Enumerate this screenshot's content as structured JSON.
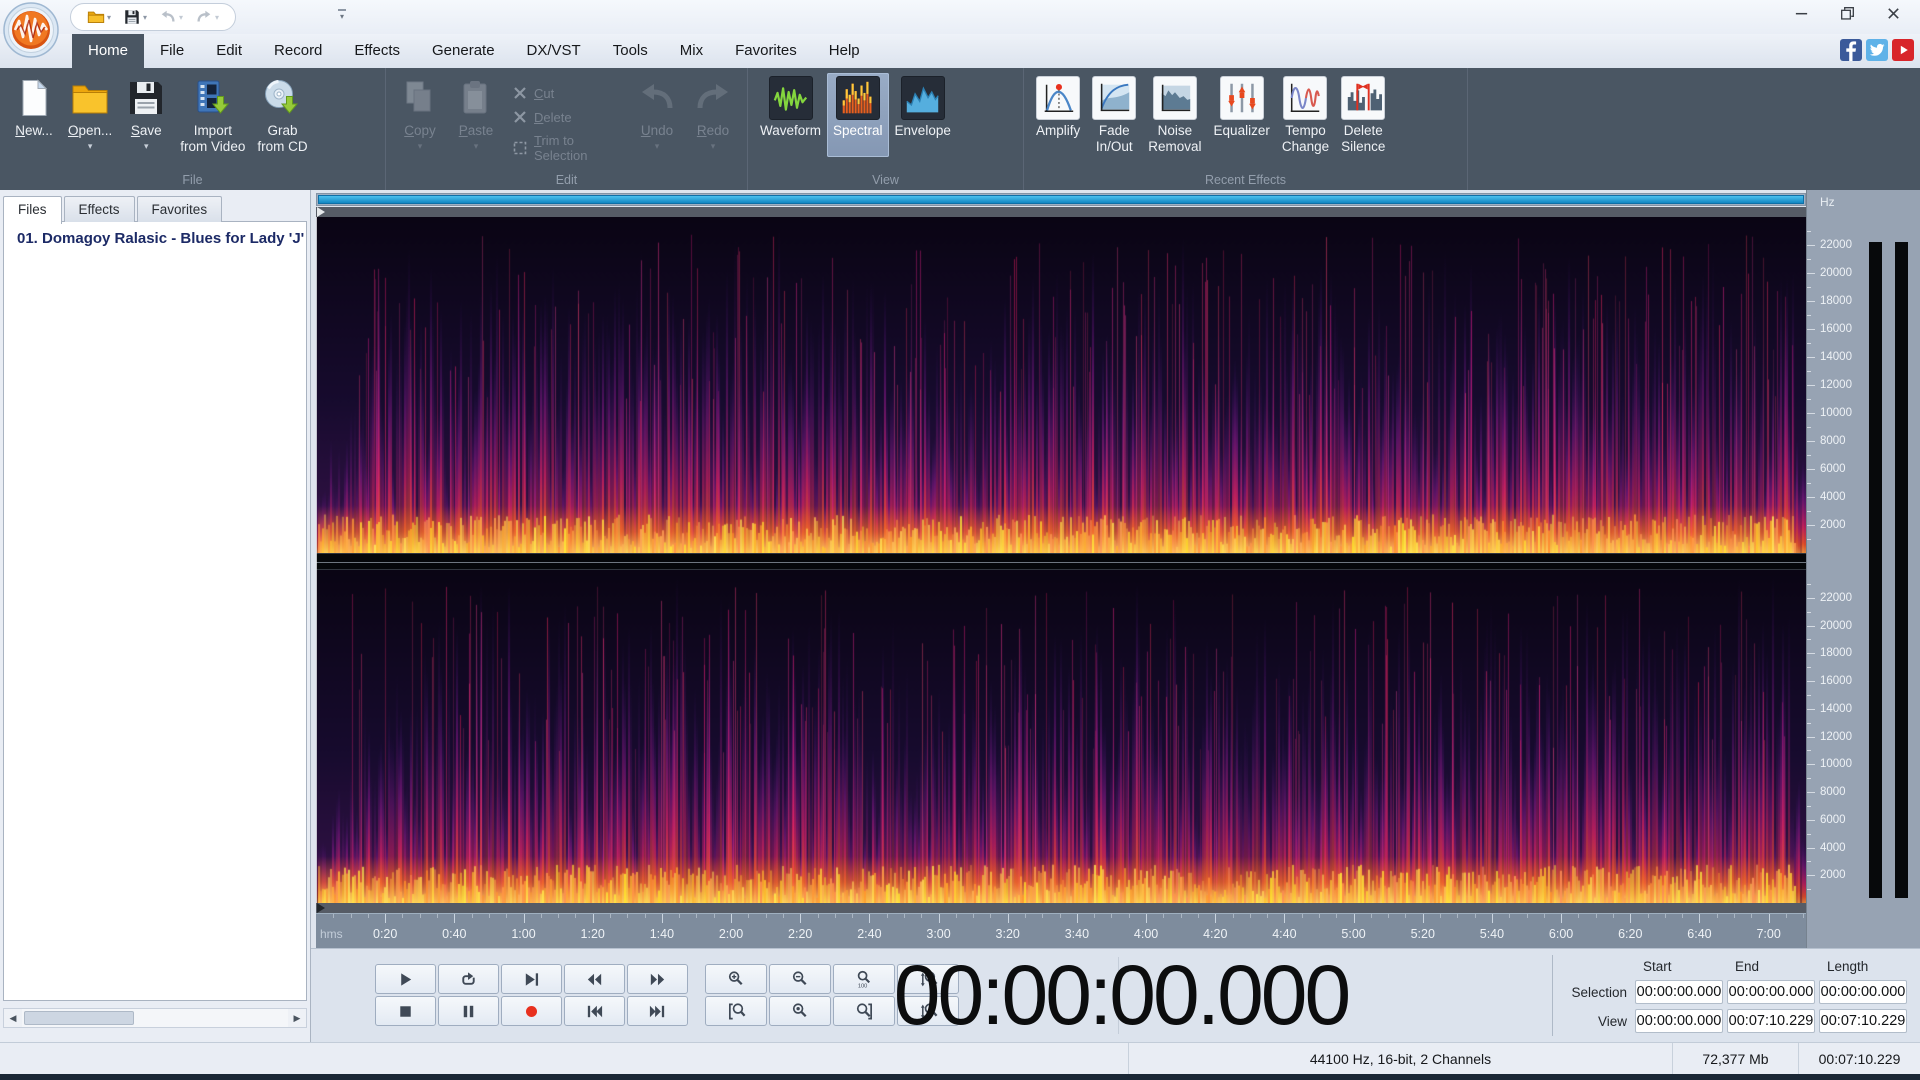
{
  "colors": {
    "ribbon_bg": "#4a5663",
    "scrollbar_accent_blue": "#1e9ad6",
    "record_red": "#e8301e",
    "brand_orange": "#e8681a",
    "facebook_blue": "#3b5a9a",
    "twitter_blue": "#5fb2e8",
    "youtube_red": "#d8252a",
    "spectrogram_palette": [
      "#0a0514",
      "#2b1060",
      "#8a1a8a",
      "#d42668",
      "#ff5a2e",
      "#ffc866"
    ]
  },
  "window": {
    "quick_access": [
      {
        "name": "open",
        "icon": "folder",
        "disabled": false
      },
      {
        "name": "save",
        "icon": "floppy",
        "disabled": false
      },
      {
        "name": "undo",
        "icon": "undo-small",
        "disabled": true
      },
      {
        "name": "redo",
        "icon": "redo-small",
        "disabled": true
      }
    ],
    "controls": [
      {
        "name": "minimize",
        "glyph": "minimize"
      },
      {
        "name": "restore",
        "glyph": "restore"
      },
      {
        "name": "close",
        "glyph": "close"
      }
    ]
  },
  "menu": {
    "tabs": [
      {
        "label": "Home",
        "active": true
      },
      {
        "label": "File"
      },
      {
        "label": "Edit"
      },
      {
        "label": "Record"
      },
      {
        "label": "Effects"
      },
      {
        "label": "Generate"
      },
      {
        "label": "DX/VST"
      },
      {
        "label": "Tools"
      },
      {
        "label": "Mix"
      },
      {
        "label": "Favorites"
      },
      {
        "label": "Help"
      }
    ],
    "social": [
      {
        "name": "facebook",
        "icon": "facebook"
      },
      {
        "name": "twitter",
        "icon": "twitter"
      },
      {
        "name": "youtube",
        "icon": "youtube"
      }
    ]
  },
  "ribbon": {
    "groups": [
      {
        "label": "File",
        "items": [
          {
            "label": "New...",
            "icon": "new-file",
            "mn": true
          },
          {
            "label": "Open...",
            "icon": "open-folder",
            "arrow": true,
            "mn": true
          },
          {
            "label": "Save",
            "icon": "save-floppy",
            "arrow": true,
            "mn": true
          },
          {
            "label": "Import\nfrom Video",
            "icon": "import-video"
          },
          {
            "label": "Grab\nfrom CD",
            "icon": "grab-cd"
          }
        ]
      },
      {
        "label": "Edit",
        "items": [
          {
            "label": "Copy",
            "icon": "copy",
            "arrow": true,
            "disabled": true,
            "mn": true
          },
          {
            "label": "Paste",
            "icon": "paste",
            "arrow": true,
            "disabled": true,
            "mn": true
          },
          {
            "label": "Cut",
            "icon": "cut-x",
            "kind": "small",
            "disabled": true,
            "mn": true
          },
          {
            "label": "Delete",
            "icon": "delete-x",
            "kind": "small",
            "disabled": true,
            "mn": true
          },
          {
            "label": "Trim to Selection",
            "icon": "trim",
            "kind": "small",
            "disabled": true,
            "mn": true
          },
          {
            "label": "Undo",
            "icon": "undo",
            "arrow": true,
            "disabled": true,
            "mn": true
          },
          {
            "label": "Redo",
            "icon": "redo",
            "arrow": true,
            "disabled": true,
            "mn": true
          }
        ]
      },
      {
        "label": "View",
        "items": [
          {
            "label": "Waveform",
            "icon": "waveform-view"
          },
          {
            "label": "Spectral",
            "icon": "spectral-view",
            "selected": true
          },
          {
            "label": "Envelope",
            "icon": "envelope-view"
          }
        ]
      },
      {
        "label": "Recent Effects",
        "items": [
          {
            "label": "Amplify",
            "icon": "amplify"
          },
          {
            "label": "Fade\nIn/Out",
            "icon": "fade"
          },
          {
            "label": "Noise\nRemoval",
            "icon": "noise-removal"
          },
          {
            "label": "Equalizer",
            "icon": "equalizer"
          },
          {
            "label": "Tempo\nChange",
            "icon": "tempo-change"
          },
          {
            "label": "Delete\nSilence",
            "icon": "delete-silence"
          }
        ]
      }
    ]
  },
  "panel": {
    "tabs": [
      {
        "label": "Files",
        "active": true
      },
      {
        "label": "Effects"
      },
      {
        "label": "Favorites"
      }
    ],
    "files": [
      {
        "title": "01. Domagoy Ralasic - Blues for Lady 'J'"
      }
    ]
  },
  "frequency_ruler": {
    "unit": "Hz",
    "max_hz": 24000,
    "channels": 2,
    "labels": [
      22000,
      20000,
      18000,
      16000,
      14000,
      12000,
      10000,
      8000,
      6000,
      4000,
      2000
    ]
  },
  "timeline": {
    "unit": "hms",
    "duration_s": 430.229,
    "major_interval_s": 20,
    "labels": [
      "0:20",
      "0:40",
      "1:00",
      "1:20",
      "1:40",
      "2:00",
      "2:20",
      "2:40",
      "3:00",
      "3:20",
      "3:40",
      "4:00",
      "4:20",
      "4:40",
      "5:00",
      "5:20",
      "5:40",
      "6:00",
      "6:20",
      "6:40",
      "7:00"
    ]
  },
  "transport": {
    "rows": [
      [
        {
          "name": "play",
          "glyph": "play"
        },
        {
          "name": "loop",
          "glyph": "loop"
        },
        {
          "name": "play-to-next",
          "glyph": "play-next"
        },
        {
          "name": "rewind",
          "glyph": "rewind"
        },
        {
          "name": "fast-forward",
          "glyph": "forward"
        }
      ],
      [
        {
          "name": "stop",
          "glyph": "stop"
        },
        {
          "name": "pause",
          "glyph": "pause"
        },
        {
          "name": "record",
          "glyph": "record"
        },
        {
          "name": "go-to-start",
          "glyph": "go-start"
        },
        {
          "name": "go-to-end",
          "glyph": "go-end"
        }
      ]
    ]
  },
  "zoom_controls": {
    "rows": [
      [
        {
          "name": "zoom-in",
          "glyph": "zoom-in"
        },
        {
          "name": "zoom-out",
          "glyph": "zoom-out"
        },
        {
          "name": "zoom-100",
          "glyph": "zoom-100"
        },
        {
          "name": "zoom-vertical-in",
          "glyph": "zoom-vert"
        }
      ],
      [
        {
          "name": "zoom-selection-start",
          "glyph": "zoom-sel-start"
        },
        {
          "name": "zoom-to-selection",
          "glyph": "zoom-sel"
        },
        {
          "name": "zoom-selection-end",
          "glyph": "zoom-sel-end"
        },
        {
          "name": "zoom-vertical-out",
          "glyph": "zoom-vert2"
        }
      ]
    ]
  },
  "time_display": {
    "value": "00:00:00.000"
  },
  "selection_panel": {
    "headers": [
      "Start",
      "End",
      "Length"
    ],
    "rows": [
      {
        "label": "Selection",
        "values": [
          "00:00:00.000",
          "00:00:00.000",
          "00:00:00.000"
        ]
      },
      {
        "label": "View",
        "values": [
          "00:00:00.000",
          "00:07:10.229",
          "00:07:10.229"
        ]
      }
    ]
  },
  "status_bar": {
    "format": "44100 Hz, 16-bit, 2 Channels",
    "file_size": "72,377 Mb",
    "duration": "00:07:10.229"
  }
}
